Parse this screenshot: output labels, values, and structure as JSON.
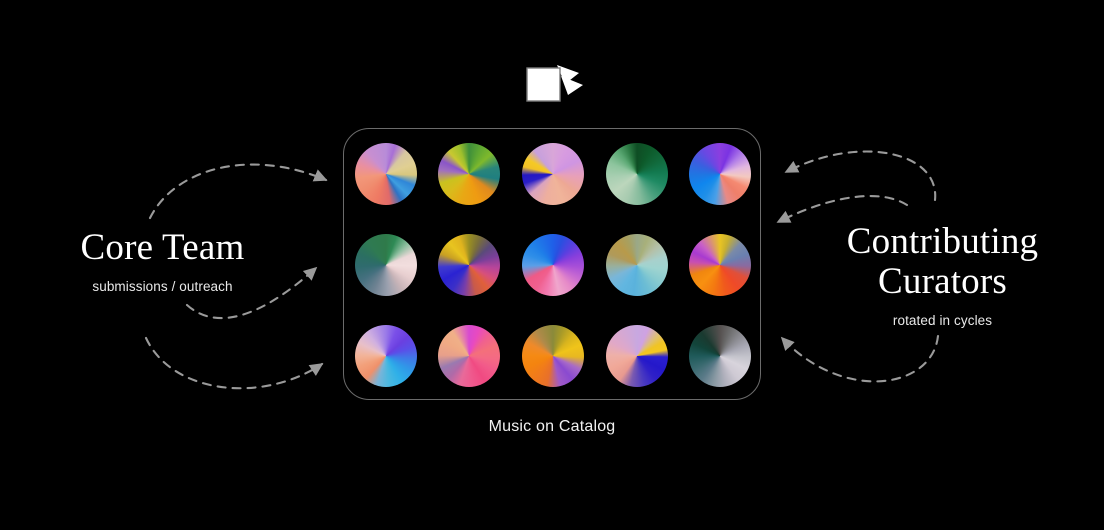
{
  "background_color": "#000000",
  "header_icon": {
    "name": "cards-stack-icon",
    "label": "Card stack",
    "color": "#ffffff"
  },
  "left_group": {
    "title": "Core Team",
    "subtitle": "submissions / outreach",
    "arrow_count": 3,
    "arrow_direction": "points-right-into-catalog"
  },
  "right_group": {
    "title": "Contributing\nCurators",
    "subtitle": "rotated in cycles",
    "arrow_count": 3,
    "arrow_direction": "points-left-into-catalog"
  },
  "catalog": {
    "caption": "Music on Catalog",
    "border_color": "#6b6b6b",
    "columns": 5,
    "rows": 3,
    "discs": [
      {
        "id": "disc-1",
        "label": "track-artwork-1",
        "gradient": "conic-gradient(from 0deg at 50% 50%, #b88cd8 0deg, #a86fd6 18deg, #d7c7a0 42deg, #e0cf92 70deg, #d8c77f 92deg, #2f86d8 112deg, #3f9fe0 134deg, #2d72c4 150deg, #e06a6a 172deg, #ef7a63 200deg, #f08c6e 232deg, #f2977a 262deg, #e98fa0 290deg, #c88fd0 320deg, #b88cd8 360deg)"
      },
      {
        "id": "disc-2",
        "label": "track-artwork-2",
        "gradient": "conic-gradient(from 0deg at 50% 50%, #3f8f3a 0deg, #5fa832 24deg, #7fb92c 48deg, #29857a 76deg, #1f7f80 100deg, #e08a1e 128deg, #ef9b12 160deg, #e8a814 196deg, #d8bc1c 228deg, #c9c21f 252deg, #a06fc0 278deg, #8a55c8 296deg, #c9c830 318deg, #9fc02c 340deg, #3f8f3a 360deg)"
      },
      {
        "id": "disc-3",
        "label": "track-artwork-3",
        "gradient": "conic-gradient(from 0deg at 50% 50%, #d9a6d8 0deg, #d79be0 30deg, #cf95e2 62deg, #e8a0b8 96deg, #eda894 130deg, #f0b49a 160deg, #eeaf9e 196deg, #d9a3c0 228deg, #2a1fc8 252deg, #2418c2 268deg, #f2c227 284deg, #f5ca24 300deg, #c7a0dc 322deg, #d9a6d8 360deg)"
      },
      {
        "id": "disc-4",
        "label": "track-artwork-4",
        "gradient": "conic-gradient(from 0deg at 50% 50%, #0e4d24 0deg, #0d5a2a 28deg, #11683a 56deg, #12794f 84deg, #1f8a63 112deg, #4aa07e 142deg, #84bb9c 172deg, #a8cbb0 202deg, #bcd6bc 232deg, #a9cfb2 262deg, #8ec59e 292deg, #5aa873 320deg, #2b7a43 342deg, #0e4d24 360deg)"
      },
      {
        "id": "disc-5",
        "label": "track-artwork-5",
        "gradient": "conic-gradient(from 0deg at 50% 50%, #8b3ee0 0deg, #7a33e2 22deg, #b07ce8 48deg, #e2b7e0 74deg, #f3c9c0 96deg, #f58a72 118deg, #ef7f6a 140deg, #e98a86 164deg, #4aa0e8 190deg, #1f8fe8 214deg, #0f86ee 240deg, #1f76e2 268deg, #3a5fe0 296deg, #6a48e2 326deg, #8b3ee0 360deg)"
      },
      {
        "id": "disc-6",
        "label": "track-artwork-6",
        "gradient": "conic-gradient(from 0deg at 50% 50%, #2f7a4a 0deg, #2e8a55 20deg, #8fbfa0 46deg, #ecd8d8 68deg, #f2dede 92deg, #e8cfd0 118deg, #c8b4b8 146deg, #9aa0ae 176deg, #6e8292 206deg, #45707f 238deg, #2f6b6e 266deg, #2b6f62 292deg, #2f7a52 322deg, #2f7a4a 360deg)"
      },
      {
        "id": "disc-7",
        "label": "track-artwork-7",
        "gradient": "conic-gradient(from 0deg at 50% 50%, #9a8f22 0deg, #7a6f3a 22deg, #5a4a7a 48deg, #7a3f9a 72deg, #b8459a 96deg, #d8507a 120deg, #e0603a 142deg, #c85a4a 166deg, #7a3fa8 190deg, #3a2fc8 214deg, #2a22d2 240deg, #3f3ad0 266deg, #c8a022 292deg, #e8c41f 318deg, #e0b41e 340deg, #9a8f22 360deg)"
      },
      {
        "id": "disc-8",
        "label": "track-artwork-8",
        "gradient": "conic-gradient(from 0deg at 50% 50%, #1f5fe8 0deg, #2a4fe0 20deg, #5a3fe0 46deg, #8a3fdc 70deg, #a84fd8 94deg, #c86ad2 118deg, #e68ac8 142deg, #f0a6cc 168deg, #f27ab0 192deg, #f0608f 216deg, #ef5a86 240deg, #5a9fe8 268deg, #2f8fe8 292deg, #1f7fe8 318deg, #1f5fe8 360deg)"
      },
      {
        "id": "disc-9",
        "label": "track-artwork-9",
        "gradient": "conic-gradient(from 0deg at 50% 50%, #9aa888 0deg, #a8b07a 22deg, #b4c0a8 48deg, #a8d0cc 74deg, #9fd4d0 100deg, #88cbd0 128deg, #6cbdd4 156deg, #5ab2dc 186deg, #62b6e0 214deg, #7ab6d8 242deg, #9aaf9a 268deg, #b09a5a 292deg, #b89a4a 318deg, #a8a060 340deg, #9aa888 360deg)"
      },
      {
        "id": "disc-10",
        "label": "track-artwork-10",
        "gradient": "conic-gradient(from 0deg at 50% 50%, #e8c424 0deg, #c8b02f 18deg, #7a8aa8 44deg, #6a80b0 68deg, #8a6aa0 92deg, #e0503a 116deg, #ef4a28 142deg, #f05a1c 168deg, #f47a10 196deg, #f89010 224deg, #f0860f 250deg, #c84fb0 276deg, #a83ad0 296deg, #c85fc8 318deg, #e8c424 360deg)"
      },
      {
        "id": "disc-11",
        "label": "track-artwork-11",
        "gradient": "conic-gradient(from 0deg at 50% 50%, #9a7ae8 0deg, #7a4fe8 22deg, #6a3fe0 48deg, #5a4fe8 72deg, #3f7ae8 96deg, #2f9ae8 122deg, #2fb0e8 148deg, #4ab8e0 174deg, #7ab4d8 198deg, #f0906a 222deg, #f2a07a 248deg, #f2b49a 272deg, #e8c0c8 296deg, #d0b0e0 322deg, #9a7ae8 360deg)"
      },
      {
        "id": "disc-12",
        "label": "track-artwork-12",
        "gradient": "conic-gradient(from 0deg at 50% 50%, #d84ad0 0deg, #e84ac0 20deg, #f0608f 44deg, #f4707a 70deg, #f46a84 96deg, #f25a8a 122deg, #f04a82 148deg, #ef5a8e 174deg, #e86a9a 198deg, #b06aa8 222deg, #9a7ab0 246deg, #e8a08a 272deg, #f0aa84 300deg, #f0b088 326deg, #d84ad0 360deg)"
      },
      {
        "id": "disc-13",
        "label": "track-artwork-13",
        "gradient": "conic-gradient(from 0deg at 50% 50%, #8a8a3a 0deg, #a89a28 20deg, #d8b41e 44deg, #f0c41a 68deg, #e8b820 92deg, #a86ac8 116deg, #8a4ad0 140deg, #a05ac8 166deg, #e8702a 192deg, #f07a1c 218deg, #f4840f 246deg, #f58a14 272deg, #ef8a2a 298deg, #b08a4a 326deg, #8a8a3a 360deg)"
      },
      {
        "id": "disc-14",
        "label": "track-artwork-14",
        "gradient": "conic-gradient(from 0deg at 50% 50%, #c8a8e0 0deg, #cfa2e2 22deg, #e0c070 46deg, #f0c424 62deg, #f4c820 78deg, #2a1fd0 92deg, #2418ca 118deg, #2f20c8 142deg, #4a3ac0 166deg, #7a5ab0 192deg, #e89a90 216deg, #f0a898 244deg, #eeb0a8 272deg, #e0a8c8 300deg, #c8a8e0 360deg)"
      },
      {
        "id": "disc-15",
        "label": "track-artwork-15",
        "gradient": "conic-gradient(from 0deg at 50% 50%, #55504f 0deg, #6a6a6a 20deg, #8a8a90 44deg, #a8a8b4 68deg, #c4c4cc 92deg, #d8d4dc 116deg, #cfcad4 142deg, #b0b0bc 168deg, #8a9aa4 192deg, #5a7a88 218deg, #3a6a70 244deg, #1f5a5a 270deg, #12443a 296deg, #1a3a30 322deg, #55504f 360deg)"
      }
    ]
  }
}
